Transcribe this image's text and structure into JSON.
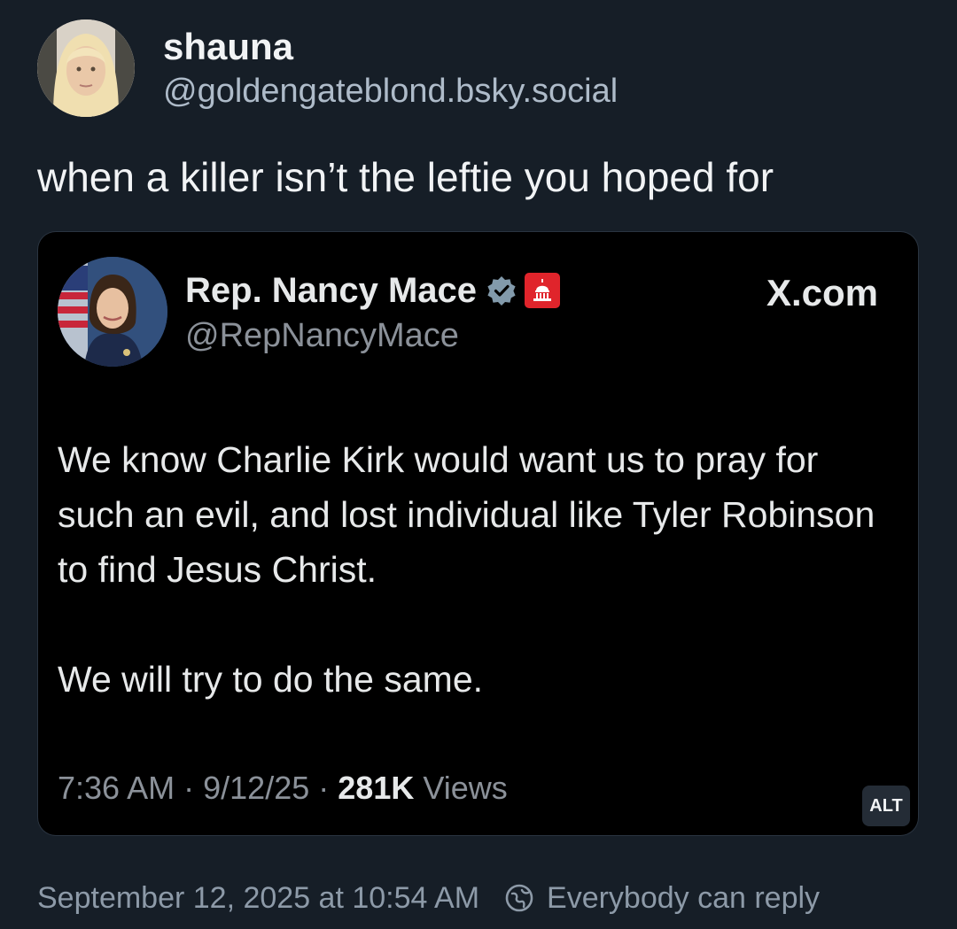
{
  "post": {
    "author": {
      "display_name": "shauna",
      "handle": "@goldengateblond.bsky.social"
    },
    "text": "when a killer isn’t the leftie you hoped for",
    "embed": {
      "author_name": "Rep. Nancy Mace",
      "author_handle": "@RepNancyMace",
      "site": "X.com",
      "body_paragraphs": [
        "We know Charlie Kirk would want us to pray for such an evil, and lost individual like Tyler Robinson to find Jesus Christ.",
        "We will try to do the same."
      ],
      "time": "7:36 AM",
      "date": "9/12/25",
      "views_count": "281K",
      "views_label": "Views",
      "separator": "·",
      "alt_label": "ALT",
      "icons": [
        "verified-icon",
        "government-badge-icon"
      ]
    },
    "timestamp": "September 12, 2025 at 10:54 AM",
    "reply_setting": "Everybody can reply"
  },
  "colors": {
    "background": "#161e27",
    "card_background": "#000000",
    "verified": "#829aab",
    "gov_badge": "#e0242b"
  }
}
